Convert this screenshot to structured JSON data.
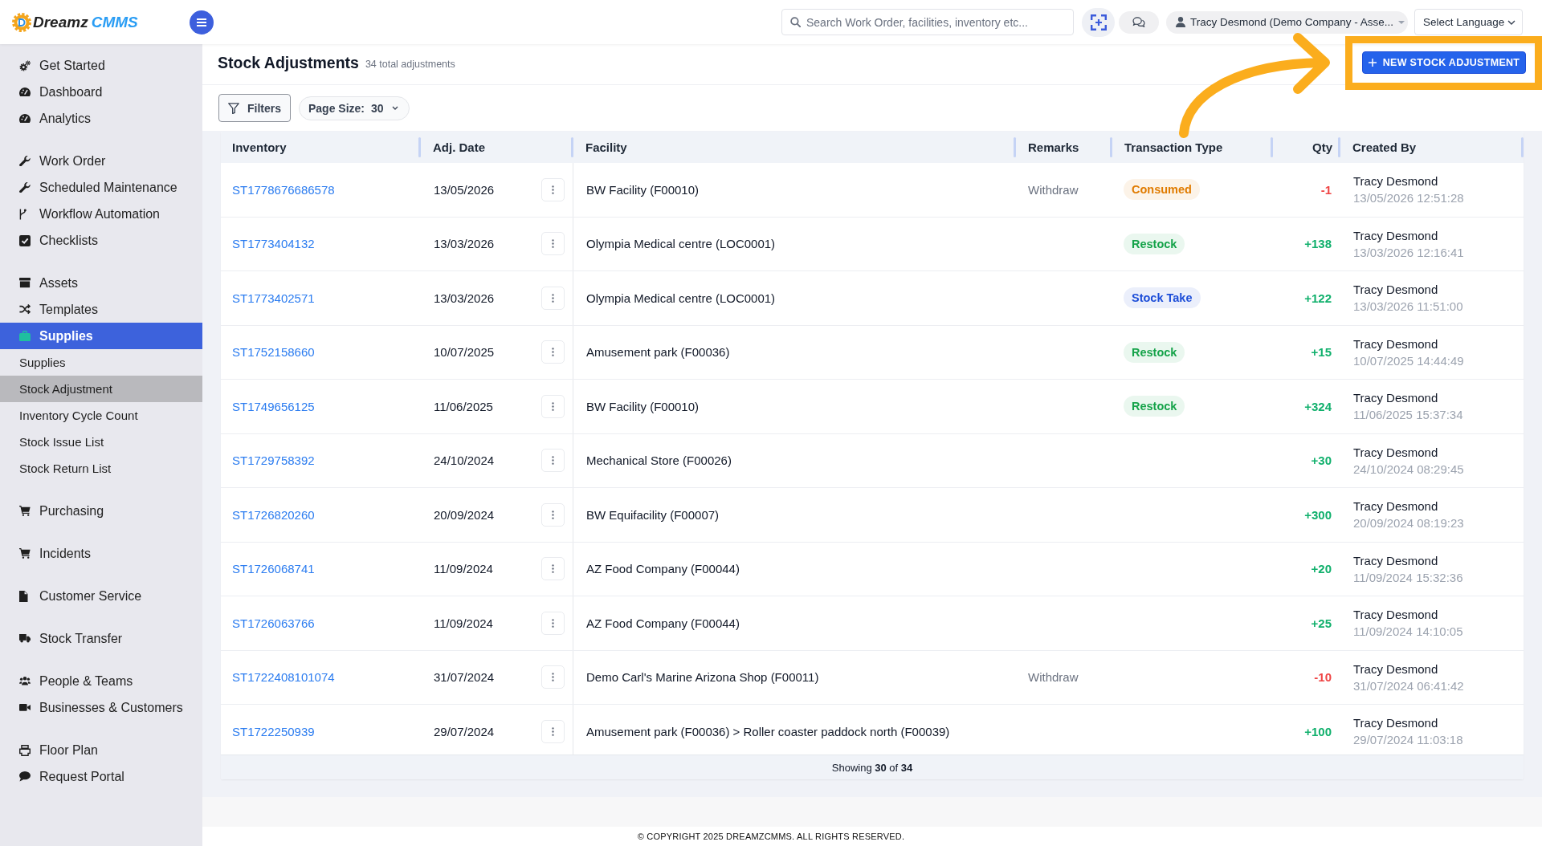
{
  "topbar": {
    "logo": {
      "name": "Dreamz",
      "suffix": "CMMS"
    },
    "search": {
      "placeholder": "Search Work Order, facilities, inventory etc..."
    },
    "user": "Tracy Desmond (Demo Company - Asse...",
    "language": "Select Language"
  },
  "sidebar": {
    "groups": [
      {
        "items": [
          {
            "label": "Get Started",
            "selected": false
          },
          {
            "label": "Dashboard",
            "selected": false
          },
          {
            "label": "Analytics",
            "selected": false
          }
        ]
      },
      {
        "items": [
          {
            "label": "Work Order",
            "selected": false
          },
          {
            "label": "Scheduled Maintenance",
            "selected": false
          },
          {
            "label": "Workflow Automation",
            "selected": false
          },
          {
            "label": "Checklists",
            "selected": false
          }
        ]
      },
      {
        "items": [
          {
            "label": "Assets",
            "selected": false
          },
          {
            "label": "Templates",
            "selected": false
          },
          {
            "label": "Supplies",
            "selected": true,
            "children": [
              {
                "label": "Supplies",
                "selected": false
              },
              {
                "label": "Stock Adjustment",
                "selected": true
              },
              {
                "label": "Inventory Cycle Count",
                "selected": false
              },
              {
                "label": "Stock Issue List",
                "selected": false
              },
              {
                "label": "Stock Return List",
                "selected": false
              }
            ]
          }
        ]
      },
      {
        "items": [
          {
            "label": "Purchasing",
            "selected": false
          }
        ]
      },
      {
        "items": [
          {
            "label": "Incidents",
            "selected": false
          }
        ]
      },
      {
        "items": [
          {
            "label": "Customer Service",
            "selected": false
          }
        ]
      },
      {
        "items": [
          {
            "label": "Stock Transfer",
            "selected": false
          }
        ]
      },
      {
        "items": [
          {
            "label": "People & Teams",
            "selected": false
          },
          {
            "label": "Businesses & Customers",
            "selected": false
          }
        ]
      },
      {
        "items": [
          {
            "label": "Floor Plan",
            "selected": false
          },
          {
            "label": "Request Portal",
            "selected": false
          }
        ]
      }
    ]
  },
  "page": {
    "title": "Stock Adjustments",
    "subtitle": "34 total adjustments",
    "new_button": "NEW STOCK ADJUSTMENT"
  },
  "toolbar": {
    "filters": "Filters",
    "page_size": {
      "label": "Page Size:",
      "value": "30"
    }
  },
  "table": {
    "columns": [
      "Inventory",
      "Adj. Date",
      "Facility",
      "Remarks",
      "Transaction Type",
      "Qty",
      "Created By"
    ],
    "rows": [
      {
        "inventory": "ST1778676686578",
        "date": "13/05/2026",
        "facility": "BW Facility (F00010)",
        "remarks": "Withdraw",
        "transaction_type": {
          "label": "Consumed",
          "color": "#e07b00"
        },
        "qty": {
          "value": "-1",
          "color": "#ef4444"
        },
        "created_by": {
          "name": "Tracy Desmond",
          "time": "13/05/2026 12:51:28"
        }
      },
      {
        "inventory": "ST1773404132",
        "date": "13/03/2026",
        "facility": "Olympia Medical centre (LOC0001)",
        "transaction_type": {
          "label": "Restock",
          "color": "#16a34a"
        },
        "qty": {
          "value": "+138",
          "color": "#10b06c"
        },
        "created_by": {
          "name": "Tracy Desmond",
          "time": "13/03/2026 12:16:41"
        }
      },
      {
        "inventory": "ST1773402571",
        "date": "13/03/2026",
        "facility": "Olympia Medical centre (LOC0001)",
        "transaction_type": {
          "label": "Stock Take",
          "color": "#1d4ed8"
        },
        "qty": {
          "value": "+122",
          "color": "#10b06c"
        },
        "created_by": {
          "name": "Tracy Desmond",
          "time": "13/03/2026 11:51:00"
        }
      },
      {
        "inventory": "ST1752158660",
        "date": "10/07/2025",
        "facility": "Amusement park (F00036)",
        "transaction_type": {
          "label": "Restock",
          "color": "#16a34a"
        },
        "qty": {
          "value": "+15",
          "color": "#10b06c"
        },
        "created_by": {
          "name": "Tracy Desmond",
          "time": "10/07/2025 14:44:49"
        }
      },
      {
        "inventory": "ST1749656125",
        "date": "11/06/2025",
        "facility": "BW Facility (F00010)",
        "transaction_type": {
          "label": "Restock",
          "color": "#16a34a"
        },
        "qty": {
          "value": "+324",
          "color": "#10b06c"
        },
        "created_by": {
          "name": "Tracy Desmond",
          "time": "11/06/2025 15:37:34"
        }
      },
      {
        "inventory": "ST1729758392",
        "date": "24/10/2024",
        "facility": "Mechanical Store (F00026)",
        "qty": {
          "value": "+30",
          "color": "#10b06c"
        },
        "created_by": {
          "name": "Tracy Desmond",
          "time": "24/10/2024 08:29:45"
        }
      },
      {
        "inventory": "ST1726820260",
        "date": "20/09/2024",
        "facility": "BW Equifacility (F00007)",
        "qty": {
          "value": "+300",
          "color": "#10b06c"
        },
        "created_by": {
          "name": "Tracy Desmond",
          "time": "20/09/2024 08:19:23"
        }
      },
      {
        "inventory": "ST1726068741",
        "date": "11/09/2024",
        "facility": "AZ Food Company (F00044)",
        "qty": {
          "value": "+20",
          "color": "#10b06c"
        },
        "created_by": {
          "name": "Tracy Desmond",
          "time": "11/09/2024 15:32:36"
        }
      },
      {
        "inventory": "ST1726063766",
        "date": "11/09/2024",
        "facility": "AZ Food Company (F00044)",
        "qty": {
          "value": "+25",
          "color": "#10b06c"
        },
        "created_by": {
          "name": "Tracy Desmond",
          "time": "11/09/2024 14:10:05"
        }
      },
      {
        "inventory": "ST1722408101074",
        "date": "31/07/2024",
        "facility": "Demo Carl's Marine Arizona Shop (F00011)",
        "remarks": "Withdraw",
        "qty": {
          "value": "-10",
          "color": "#ef4444"
        },
        "created_by": {
          "name": "Tracy Desmond",
          "time": "31/07/2024 06:41:42"
        }
      },
      {
        "inventory": "ST1722250939",
        "date": "29/07/2024",
        "facility": "Amusement park (F00036) > Roller coaster paddock north (F00039)",
        "qty": {
          "value": "+100",
          "color": "#10b06c"
        },
        "created_by": {
          "name": "Tracy Desmond",
          "time": "29/07/2024 11:03:18"
        }
      }
    ],
    "footer": "Showing **30** of **34**"
  },
  "copyright": "© COPYRIGHT 2025 DREAMZCMMS. ALL RIGHTS RESERVED."
}
